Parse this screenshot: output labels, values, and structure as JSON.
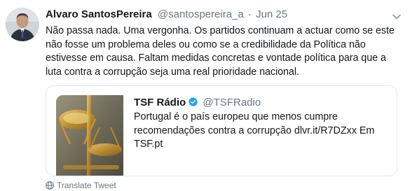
{
  "tweet": {
    "author_name": "Alvaro SantosPereira",
    "author_handle": "@santospereira_a",
    "separator": "·",
    "date": "Jun 25",
    "text": "Não passa nada. Uma vergonha. Os partidos continuam a actuar como se este não fosse um problema deles ou como se a credibilidade da Política não estivesse em causa. Faltam medidas concretas e vontade política para que a luta contra a corrupção seja uma real prioridade nacional."
  },
  "quoted": {
    "name": "TSF Rádio",
    "handle": "@TSFRadio",
    "text": "Portugal é o país europeu que menos cumpre recomendações contra a corrupção dlvr.it/R7DZxx Em TSF.pt"
  },
  "translate_label": "Translate Tweet",
  "icons": {
    "caret": "chevron-down-icon",
    "verified": "verified-badge-icon",
    "globe": "globe-icon"
  },
  "colors": {
    "text": "#14171a",
    "secondary": "#657786",
    "verified": "#1da1f2",
    "border": "#e1e8ed"
  }
}
